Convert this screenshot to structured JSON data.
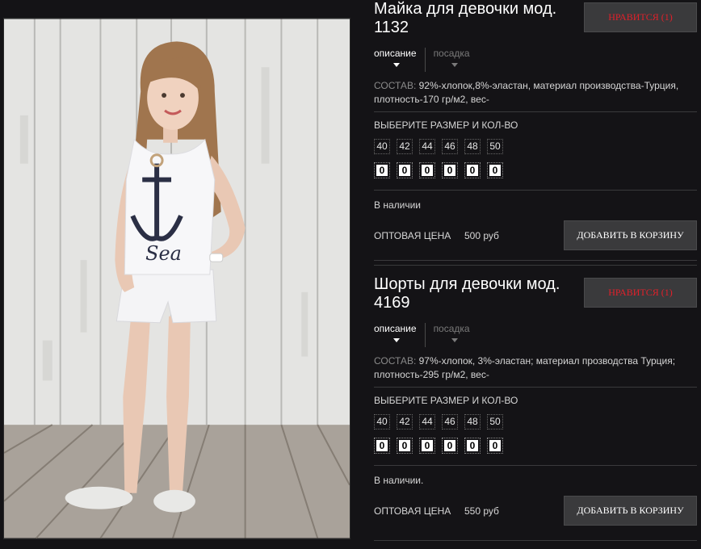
{
  "products": [
    {
      "title": "Майка для девочки мод. 1132",
      "like_label": "НРАВИТСЯ (1)",
      "tabs": [
        {
          "label": "описание"
        },
        {
          "label": "посадка"
        }
      ],
      "desc_label": "СОСТАВ:",
      "desc_text": " 92%-хлопок,8%-эластан, материал производства-Турция, плотность-170 гр/м2, вес-",
      "sizes_label": "ВЫБЕРИТЕ РАЗМЕР И КОЛ-ВО",
      "sizes": [
        "40",
        "42",
        "44",
        "46",
        "48",
        "50"
      ],
      "quantities": [
        "0",
        "0",
        "0",
        "0",
        "0",
        "0"
      ],
      "stock": "В наличии",
      "price_label": "ОПТОВАЯ ЦЕНА",
      "price": "500 руб",
      "cart_label": "ДОБАВИТЬ В КОРЗИНУ"
    },
    {
      "title": "Шорты для девочки мод. 4169",
      "like_label": "НРАВИТСЯ (1)",
      "tabs": [
        {
          "label": "описание"
        },
        {
          "label": "посадка"
        }
      ],
      "desc_label": "СОСТАВ:",
      "desc_text": " 97%-хлопок, 3%-эластан; материал прозводства Турция; плотность-295 гр/м2, вес-",
      "sizes_label": "ВЫБЕРИТЕ РАЗМЕР И КОЛ-ВО",
      "sizes": [
        "40",
        "42",
        "44",
        "46",
        "48",
        "50"
      ],
      "quantities": [
        "0",
        "0",
        "0",
        "0",
        "0",
        "0"
      ],
      "stock": "В наличии.",
      "price_label": "ОПТОВАЯ ЦЕНА",
      "price": "550 руб",
      "cart_label": "ДОБАВИТЬ В КОРЗИНУ"
    }
  ],
  "photo": {
    "shirt_print_text": "Sea"
  },
  "colors": {
    "background": "#141316",
    "button_bg": "#3a3a3c",
    "like_text": "#e0202a",
    "text": "#d6d6d6"
  }
}
